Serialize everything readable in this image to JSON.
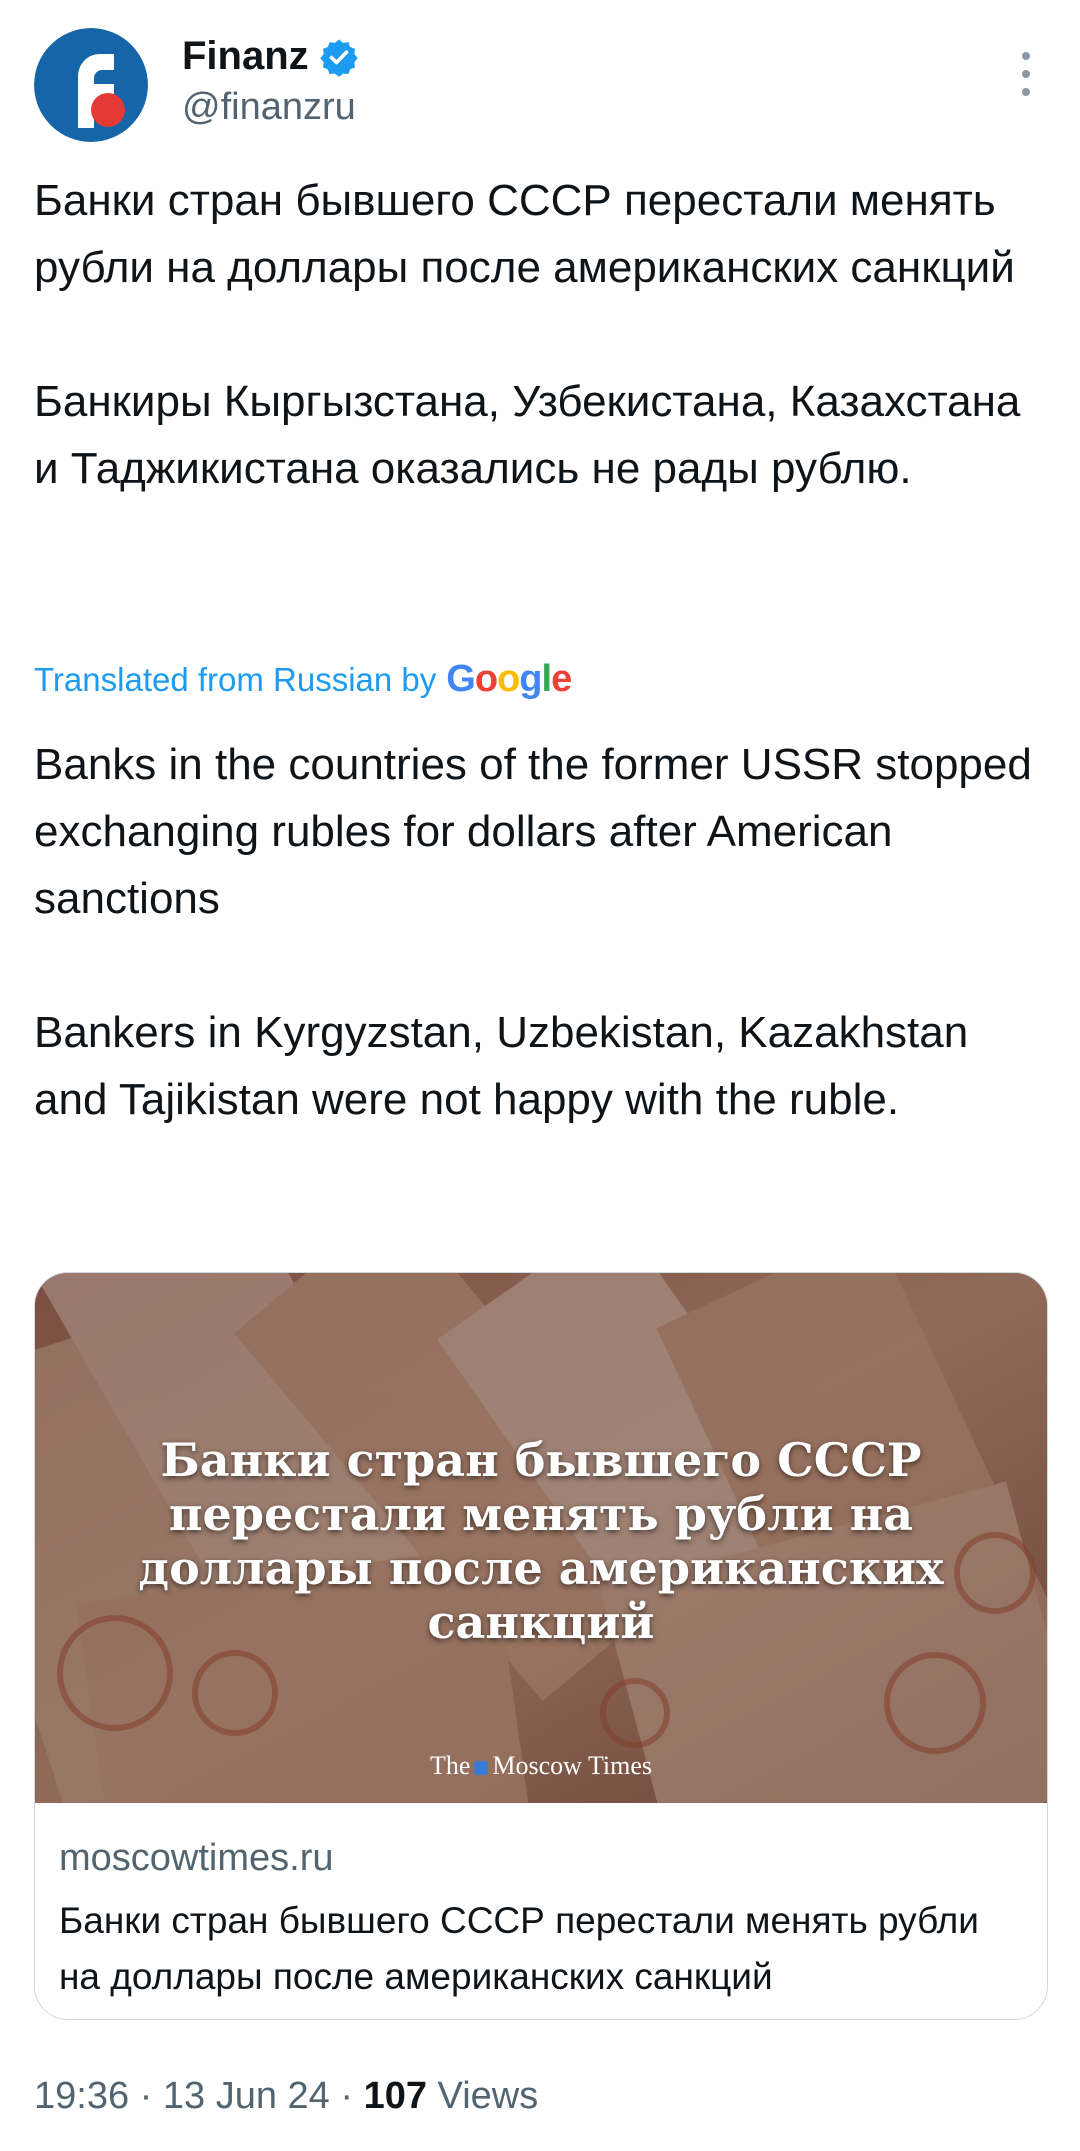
{
  "author": {
    "name": "Finanz",
    "handle": "@finanzru",
    "avatar_icon": "finanz-f-logo-icon",
    "verified_icon": "verified-badge-icon",
    "brand_color": "#1565a8",
    "verified_color": "#1d9bf0"
  },
  "more_icon": "more-options-icon",
  "tweet": {
    "original_text": "Банки стран бывшего СССР перестали менять рубли на доллары после американских санкций\n\nБанкиры Кыргызстана, Узбекистана, Казахстана и Таджикистана оказались не рады рублю.",
    "translated_label": "Translated from Russian by",
    "translated_provider": "Google",
    "translated_text": "Banks in the countries of the former USSR stopped exchanging rubles for dollars after American sanctions\n\nBankers in Kyrgyzstan, Uzbekistan, Kazakhstan and Tajikistan were not happy with the ruble."
  },
  "card": {
    "image_headline": "Банки стран бывшего СССР перестали менять рубли на доллары после американских санкций",
    "image_logo_left": "The",
    "image_logo_right": "Moscow Times",
    "domain": "moscowtimes.ru",
    "title": "Банки стран бывшего СССР перестали менять рубли на доллары после американских санкций"
  },
  "meta": {
    "time": "19:36",
    "date": "13 Jun 24",
    "separator": "·",
    "views_count": "107",
    "views_label": "Views"
  }
}
